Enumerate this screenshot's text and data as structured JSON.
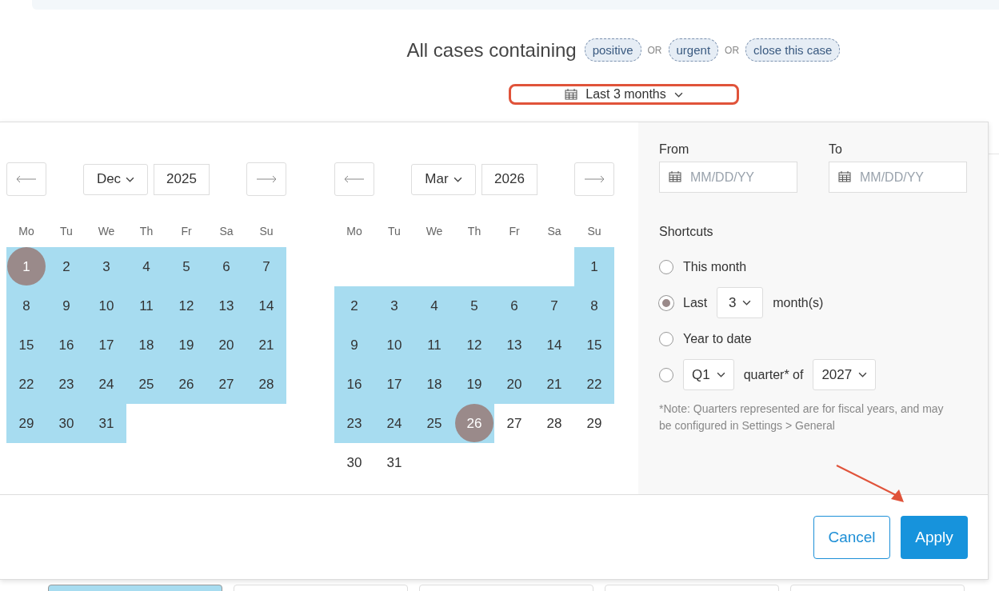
{
  "header": {
    "title": "All cases containing",
    "terms": [
      "positive",
      "urgent",
      "close this case"
    ],
    "joiners": [
      "OR",
      "OR"
    ]
  },
  "range_dropdown": {
    "label": "Last 3 months"
  },
  "calendars": [
    {
      "month": "Dec",
      "year": "2025",
      "weekdays": [
        "Mo",
        "Tu",
        "We",
        "Th",
        "Fr",
        "Sa",
        "Su"
      ],
      "weeks": [
        {
          "days": [
            {
              "day": "1",
              "in_range": true,
              "selected": true
            },
            {
              "day": "2",
              "in_range": true,
              "selected": false
            },
            {
              "day": "3",
              "in_range": true,
              "selected": false
            },
            {
              "day": "4",
              "in_range": true,
              "selected": false
            },
            {
              "day": "5",
              "in_range": true,
              "selected": false
            },
            {
              "day": "6",
              "in_range": true,
              "selected": false
            },
            {
              "day": "7",
              "in_range": true,
              "selected": false
            }
          ]
        },
        {
          "days": [
            {
              "day": "8",
              "in_range": true,
              "selected": false
            },
            {
              "day": "9",
              "in_range": true,
              "selected": false
            },
            {
              "day": "10",
              "in_range": true,
              "selected": false
            },
            {
              "day": "11",
              "in_range": true,
              "selected": false
            },
            {
              "day": "12",
              "in_range": true,
              "selected": false
            },
            {
              "day": "13",
              "in_range": true,
              "selected": false
            },
            {
              "day": "14",
              "in_range": true,
              "selected": false
            }
          ]
        },
        {
          "days": [
            {
              "day": "15",
              "in_range": true,
              "selected": false
            },
            {
              "day": "16",
              "in_range": true,
              "selected": false
            },
            {
              "day": "17",
              "in_range": true,
              "selected": false
            },
            {
              "day": "18",
              "in_range": true,
              "selected": false
            },
            {
              "day": "19",
              "in_range": true,
              "selected": false
            },
            {
              "day": "20",
              "in_range": true,
              "selected": false
            },
            {
              "day": "21",
              "in_range": true,
              "selected": false
            }
          ]
        },
        {
          "days": [
            {
              "day": "22",
              "in_range": true,
              "selected": false
            },
            {
              "day": "23",
              "in_range": true,
              "selected": false
            },
            {
              "day": "24",
              "in_range": true,
              "selected": false
            },
            {
              "day": "25",
              "in_range": true,
              "selected": false
            },
            {
              "day": "26",
              "in_range": true,
              "selected": false
            },
            {
              "day": "27",
              "in_range": true,
              "selected": false
            },
            {
              "day": "28",
              "in_range": true,
              "selected": false
            }
          ]
        },
        {
          "right_aligned": false,
          "days": [
            {
              "day": "29",
              "in_range": true,
              "selected": false
            },
            {
              "day": "30",
              "in_range": true,
              "selected": false
            },
            {
              "day": "31",
              "in_range": true,
              "selected": false
            }
          ]
        }
      ]
    },
    {
      "month": "Mar",
      "year": "2026",
      "weekdays": [
        "Mo",
        "Tu",
        "We",
        "Th",
        "Fr",
        "Sa",
        "Su"
      ],
      "weeks": [
        {
          "right_aligned": true,
          "days": [
            {
              "day": "1",
              "in_range": true,
              "selected": false
            }
          ]
        },
        {
          "days": [
            {
              "day": "2",
              "in_range": true,
              "selected": false
            },
            {
              "day": "3",
              "in_range": true,
              "selected": false
            },
            {
              "day": "4",
              "in_range": true,
              "selected": false
            },
            {
              "day": "5",
              "in_range": true,
              "selected": false
            },
            {
              "day": "6",
              "in_range": true,
              "selected": false
            },
            {
              "day": "7",
              "in_range": true,
              "selected": false
            },
            {
              "day": "8",
              "in_range": true,
              "selected": false
            }
          ]
        },
        {
          "days": [
            {
              "day": "9",
              "in_range": true,
              "selected": false
            },
            {
              "day": "10",
              "in_range": true,
              "selected": false
            },
            {
              "day": "11",
              "in_range": true,
              "selected": false
            },
            {
              "day": "12",
              "in_range": true,
              "selected": false
            },
            {
              "day": "13",
              "in_range": true,
              "selected": false
            },
            {
              "day": "14",
              "in_range": true,
              "selected": false
            },
            {
              "day": "15",
              "in_range": true,
              "selected": false
            }
          ]
        },
        {
          "days": [
            {
              "day": "16",
              "in_range": true,
              "selected": false
            },
            {
              "day": "17",
              "in_range": true,
              "selected": false
            },
            {
              "day": "18",
              "in_range": true,
              "selected": false
            },
            {
              "day": "19",
              "in_range": true,
              "selected": false
            },
            {
              "day": "20",
              "in_range": true,
              "selected": false
            },
            {
              "day": "21",
              "in_range": true,
              "selected": false
            },
            {
              "day": "22",
              "in_range": true,
              "selected": false
            }
          ]
        },
        {
          "days": [
            {
              "day": "23",
              "in_range": true,
              "selected": false
            },
            {
              "day": "24",
              "in_range": true,
              "selected": false
            },
            {
              "day": "25",
              "in_range": true,
              "selected": false
            },
            {
              "day": "26",
              "in_range": true,
              "selected": true
            },
            {
              "day": "27",
              "in_range": false,
              "selected": false
            },
            {
              "day": "28",
              "in_range": false,
              "selected": false
            },
            {
              "day": "29",
              "in_range": false,
              "selected": false
            }
          ]
        },
        {
          "right_aligned": false,
          "days": [
            {
              "day": "30",
              "in_range": false,
              "selected": false
            },
            {
              "day": "31",
              "in_range": false,
              "selected": false
            }
          ]
        }
      ]
    }
  ],
  "from": {
    "label": "From",
    "placeholder": "MM/DD/YY"
  },
  "to": {
    "label": "To",
    "placeholder": "MM/DD/YY"
  },
  "shortcuts": {
    "title": "Shortcuts",
    "options": [
      {
        "kind": "plain",
        "label": "This month",
        "selected": false
      },
      {
        "kind": "last_n",
        "prefix": "Last",
        "count": "3",
        "suffix": "month(s)",
        "selected": true
      },
      {
        "kind": "plain",
        "label": "Year to date",
        "selected": false
      },
      {
        "kind": "quarter",
        "quarter": "Q1",
        "middle": "quarter* of",
        "year": "2027",
        "selected": false
      }
    ],
    "note": "*Note: Quarters represented are for fiscal years, and may be configured in Settings > General"
  },
  "buttons": {
    "cancel": "Cancel",
    "apply": "Apply"
  }
}
